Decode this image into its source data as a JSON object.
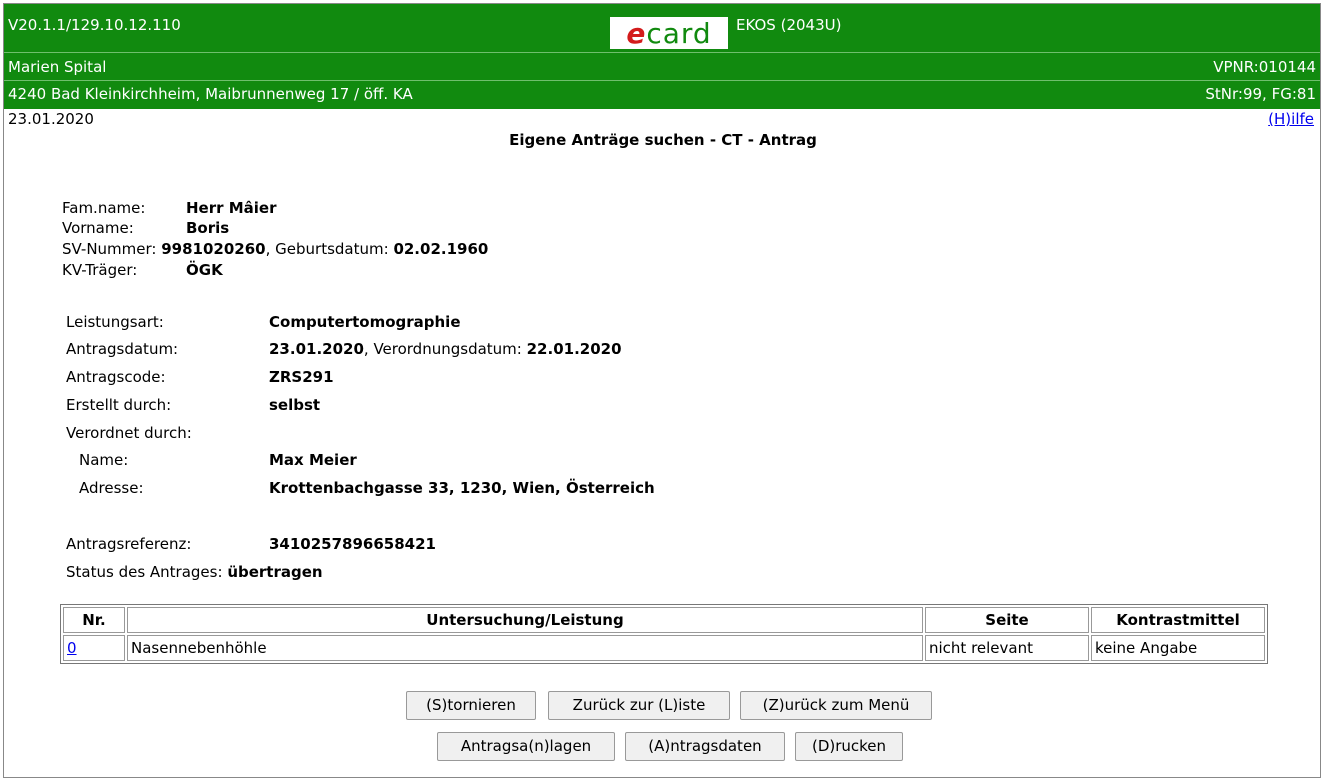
{
  "header": {
    "version": "V20.1.1/129.10.12.110",
    "logo_text": "card",
    "logo_e": "e",
    "app": "EKOS (2043U)",
    "org": "Marien Spital",
    "vpnr": "VPNR:010144",
    "address": "4240 Bad Kleinkirchheim, Maibrunnenweg 17 / öff. KA",
    "stnr": "StNr:99, FG:81"
  },
  "date": "23.01.2020",
  "help": "(H)ilfe",
  "page_title": "Eigene Anträge suchen - CT - Antrag",
  "patient": {
    "famname_label": "Fam.name:",
    "famname": "Herr Mâier",
    "vorname_label": "Vorname:",
    "vorname": "Boris",
    "sv_label": "SV-Nummer:",
    "sv": "9981020260",
    "geb_label": ", Geburtsdatum:",
    "geb": "02.02.1960",
    "kv_label": "KV-Träger:",
    "kv": "ÖGK"
  },
  "antrag": {
    "leistungsart_label": "Leistungsart:",
    "leistungsart": "Computertomographie",
    "antragsdatum_label": "Antragsdatum:",
    "antragsdatum": "23.01.2020",
    "verordnungsdatum_label": ", Verordnungsdatum:",
    "verordnungsdatum": "22.01.2020",
    "antragscode_label": "Antragscode:",
    "antragscode": "ZRS291",
    "erstellt_label": "Erstellt durch:",
    "erstellt": "selbst",
    "verordnet_label": "Verordnet durch:",
    "name_label": "Name:",
    "name": "Max Meier",
    "adresse_label": "Adresse:",
    "adresse": "Krottenbachgasse 33, 1230, Wien, Österreich",
    "referenz_label": "Antragsreferenz:",
    "referenz": "3410257896658421",
    "status_label": "Status des Antrages:",
    "status": "übertragen"
  },
  "table": {
    "headers": [
      "Nr.",
      "Untersuchung/Leistung",
      "Seite",
      "Kontrastmittel"
    ],
    "rows": [
      [
        "0",
        "Nasennebenhöhle",
        "nicht relevant",
        "keine Angabe"
      ]
    ]
  },
  "buttons": {
    "stornieren": "(S)tornieren",
    "liste": "Zurück zur (L)iste",
    "menu": "(Z)urück zum Menü",
    "anlagen": "Antragsa(n)lagen",
    "daten": "(A)ntragsdaten",
    "drucken": "(D)rucken"
  }
}
